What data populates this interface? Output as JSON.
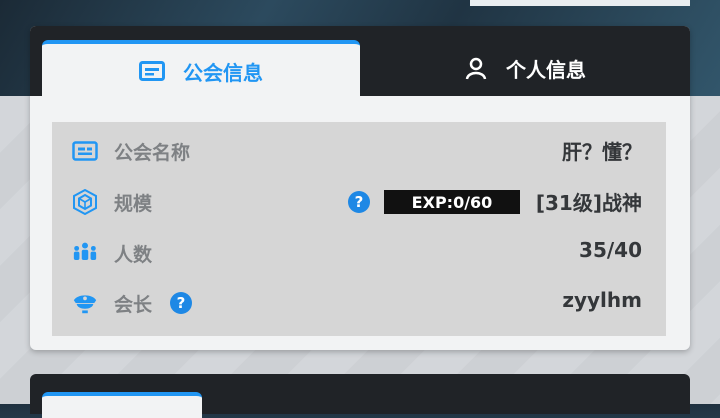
{
  "tabs": [
    {
      "label": "公会信息",
      "icon": "id-card-icon",
      "active": true
    },
    {
      "label": "个人信息",
      "icon": "person-icon",
      "active": false
    }
  ],
  "guild": {
    "name": {
      "label": "公会名称",
      "value": "肝？懂？",
      "icon": "id-card-icon"
    },
    "scale": {
      "label": "规模",
      "value": "[31级]战神",
      "icon": "cube-icon",
      "exp_text": "EXP:0/60",
      "exp_progress": 0,
      "help_icon": "question-icon"
    },
    "members": {
      "label": "人数",
      "value": "35/40",
      "icon": "people-group-icon"
    },
    "leader": {
      "label": "会长",
      "value": "zyylhm",
      "icon": "captain-hat-icon",
      "help_icon": "question-icon"
    }
  },
  "colors": {
    "accent": "#2196f3",
    "tab_bar": "#202327",
    "panel": "#d6d6d6",
    "label": "#7e8184",
    "value": "#34373a"
  }
}
